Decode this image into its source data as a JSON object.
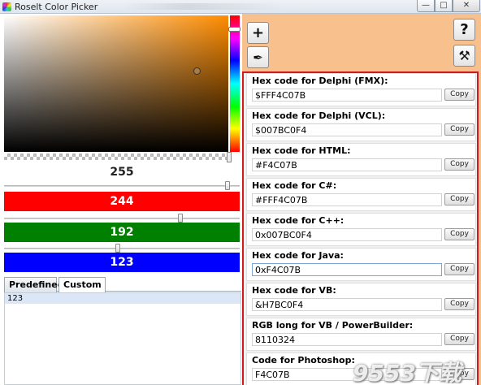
{
  "window": {
    "title": "Roselt Color Picker",
    "minimize_glyph": "—",
    "maximize_glyph": "□",
    "close_glyph": "✕"
  },
  "color": {
    "hex": "#F4C07B",
    "alpha": "255",
    "red": "244",
    "green": "192",
    "blue": "123"
  },
  "toolbar": {
    "add_icon": "plus-icon",
    "add_glyph": "+",
    "eyedropper_icon": "eyedropper-icon",
    "eyedropper_glyph": "✒",
    "help_icon": "help-icon",
    "help_glyph": "?",
    "settings_icon": "tools-icon",
    "settings_glyph": "⚒"
  },
  "tabs": [
    {
      "label": "Predefined"
    },
    {
      "label": "Custom"
    }
  ],
  "custom_list": [
    "123"
  ],
  "codes": [
    {
      "label": "Hex code for Delphi (FMX):",
      "value": "$FFF4C07B",
      "copy": "Copy"
    },
    {
      "label": "Hex code for Delphi (VCL):",
      "value": "$007BC0F4",
      "copy": "Copy"
    },
    {
      "label": "Hex code for HTML:",
      "value": "#F4C07B",
      "copy": "Copy"
    },
    {
      "label": "Hex code for C#:",
      "value": "#FFF4C07B",
      "copy": "Copy"
    },
    {
      "label": "Hex code for C++:",
      "value": "0x007BC0F4",
      "copy": "Copy"
    },
    {
      "label": "Hex code for Java:",
      "value": "0xF4C07B",
      "copy": "Copy"
    },
    {
      "label": "Hex code for VB:",
      "value": "&H7BC0F4",
      "copy": "Copy"
    },
    {
      "label": "RGB long for VB / PowerBuilder:",
      "value": "8110324",
      "copy": "Copy"
    },
    {
      "label": "Code for Photoshop:",
      "value": "F4C07B",
      "copy": "Copy"
    }
  ],
  "watermark": "9553下载",
  "colors": {
    "panel_accent": "#F7C08C",
    "highlight_border": "#D11A1A"
  }
}
